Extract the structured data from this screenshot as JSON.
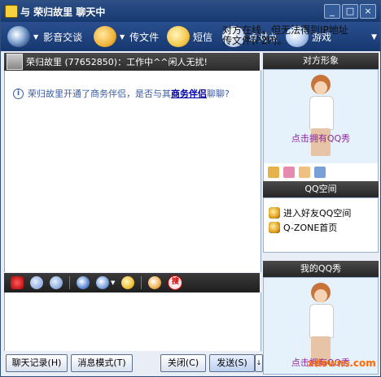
{
  "window": {
    "title": "与  荣归故里  聊天中",
    "controls": {
      "minimize": "_",
      "maximize": "□",
      "close": "×"
    }
  },
  "toolbar": {
    "items": [
      {
        "label": "影音交谈",
        "icon": "video-icon"
      },
      {
        "label": "传文件",
        "icon": "file-icon"
      },
      {
        "label": "短信",
        "icon": "sms-icon"
      },
      {
        "label": "点对点",
        "icon": "p2p-icon"
      },
      {
        "label": "游戏",
        "icon": "game-icon"
      }
    ],
    "overlay_text": "对方在线，但无法得到IP地址传文件(P2P)。",
    "scroll_arrow": "▼"
  },
  "chat": {
    "header": "荣归故里 (77652850)：工作中^^闲人无扰!",
    "system_message": {
      "prefix": "荣归故里开通了商务伴侣，是否与其",
      "link": "商务伴侣",
      "suffix": "聊聊?"
    }
  },
  "buttons": {
    "history": "聊天记录(H)",
    "mode": "消息模式(T)",
    "close": "关闭(C)",
    "send": "发送(S)",
    "send_arrow": "↓"
  },
  "right": {
    "peer_panel_title": "对方形象",
    "peer_avatar_label": "点击拥有QQ秀",
    "qzone_title": "QQ空间",
    "qzone_links": [
      "进入好友QQ空间",
      "Q-ZONE首页"
    ],
    "my_panel_title": "我的QQ秀",
    "my_avatar_label": "点击拥有QQ秀"
  },
  "watermark": "xdowns.com"
}
